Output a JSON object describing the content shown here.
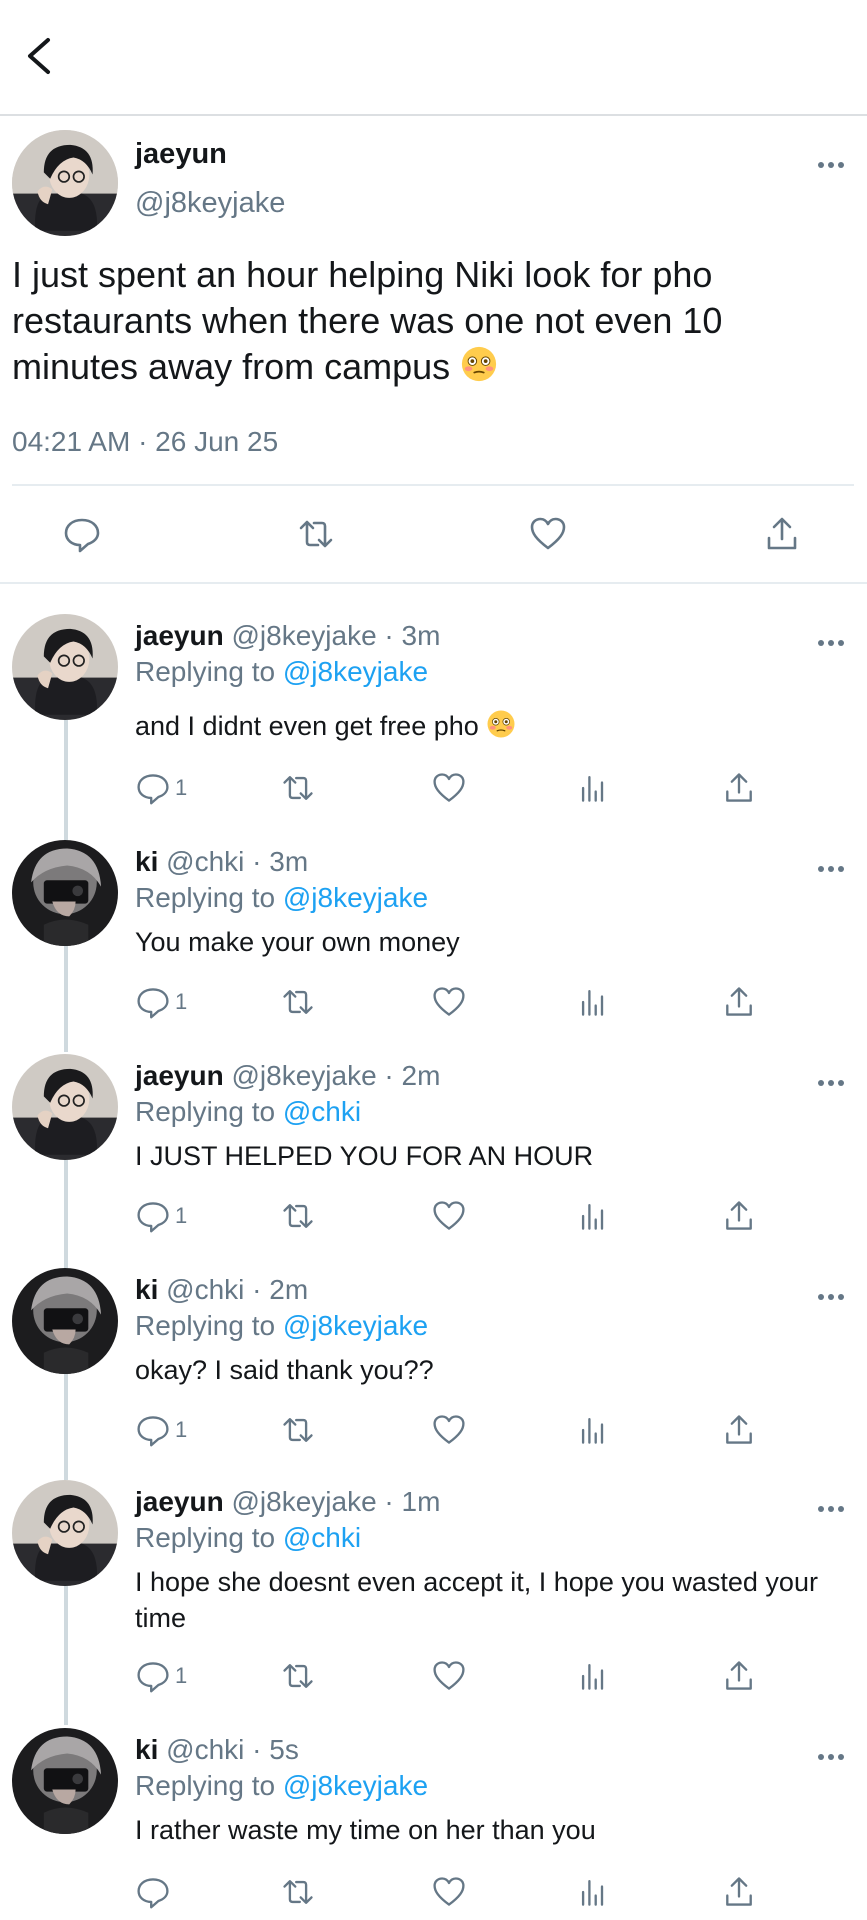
{
  "main_tweet": {
    "name": "jaeyun",
    "handle": "@j8keyjake",
    "text": "I just spent an hour helping Niki look for pho restaurants when there was one not even 10 minutes away from campus",
    "emoji": "flushed-face",
    "timestamp": "04:21 AM · 26 Jun 25"
  },
  "replies": [
    {
      "name": "jaeyun",
      "handle": "@j8keyjake",
      "time": "· 3m",
      "replying_prefix": "Replying to ",
      "replying_to": "@j8keyjake",
      "text": "and I didnt even get free pho",
      "emoji": "flushed-face",
      "reply_count": "1",
      "avatar": "jaeyun"
    },
    {
      "name": "ki",
      "handle": "@chki",
      "time": "· 3m",
      "replying_prefix": "Replying to ",
      "replying_to": "@j8keyjake",
      "text": "You make your own money",
      "reply_count": "1",
      "avatar": "ki"
    },
    {
      "name": "jaeyun",
      "handle": "@j8keyjake",
      "time": "· 2m",
      "replying_prefix": "Replying to ",
      "replying_to": "@chki",
      "text": "I JUST HELPED YOU FOR AN HOUR",
      "reply_count": "1",
      "avatar": "jaeyun"
    },
    {
      "name": "ki",
      "handle": "@chki",
      "time": "· 2m",
      "replying_prefix": "Replying to ",
      "replying_to": "@j8keyjake",
      "text": "okay? I said thank you??",
      "reply_count": "1",
      "avatar": "ki"
    },
    {
      "name": "jaeyun",
      "handle": "@j8keyjake",
      "time": "· 1m",
      "replying_prefix": "Replying to ",
      "replying_to": "@chki",
      "text": "I hope she doesnt even accept it, I hope you wasted your time",
      "reply_count": "1",
      "avatar": "jaeyun"
    },
    {
      "name": "ki",
      "handle": "@chki",
      "time": "· 5s",
      "replying_prefix": "Replying to ",
      "replying_to": "@j8keyjake",
      "text": "I rather waste my time on her than you",
      "reply_count": "",
      "avatar": "ki"
    }
  ],
  "colors": {
    "link": "#1da1f2",
    "secondary": "#657786",
    "text": "#14171a",
    "divider": "#e6ecf0"
  }
}
